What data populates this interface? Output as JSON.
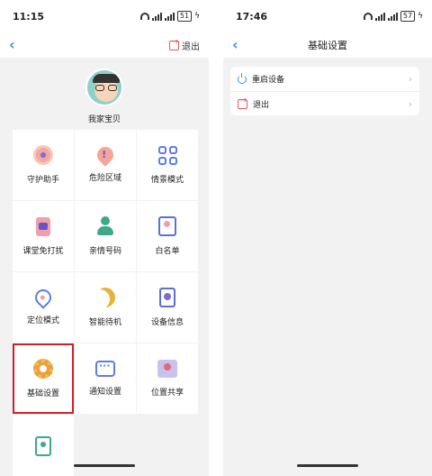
{
  "left": {
    "status": {
      "time": "11:15",
      "battery": "51"
    },
    "nav": {
      "back": "‹",
      "logout": "退出"
    },
    "profile": {
      "name": "我家宝贝"
    },
    "tiles": [
      {
        "label": "守护助手",
        "icon": "guardian-icon"
      },
      {
        "label": "危险区域",
        "icon": "danger-zone-icon"
      },
      {
        "label": "情景模式",
        "icon": "scene-mode-icon"
      },
      {
        "label": "课堂免打扰",
        "icon": "class-dnd-icon"
      },
      {
        "label": "亲情号码",
        "icon": "family-number-icon"
      },
      {
        "label": "白名单",
        "icon": "whitelist-icon"
      },
      {
        "label": "定位模式",
        "icon": "location-mode-icon"
      },
      {
        "label": "智能待机",
        "icon": "smart-standby-icon"
      },
      {
        "label": "设备信息",
        "icon": "device-info-icon"
      },
      {
        "label": "基础设置",
        "icon": "gear-icon",
        "selected": true
      },
      {
        "label": "通知设置",
        "icon": "notification-icon"
      },
      {
        "label": "位置共享",
        "icon": "location-share-icon"
      },
      {
        "label": "",
        "icon": "badge-icon"
      }
    ]
  },
  "right": {
    "status": {
      "time": "17:46",
      "battery": "57"
    },
    "nav": {
      "back": "‹",
      "title": "基础设置"
    },
    "settings": [
      {
        "label": "重启设备",
        "icon": "power-icon"
      },
      {
        "label": "退出",
        "icon": "exit-icon"
      }
    ],
    "chevron": "›"
  },
  "colors": {
    "accent": "#3a8ee6",
    "highlight_border": "#d0202a",
    "exit": "#e05a68"
  }
}
